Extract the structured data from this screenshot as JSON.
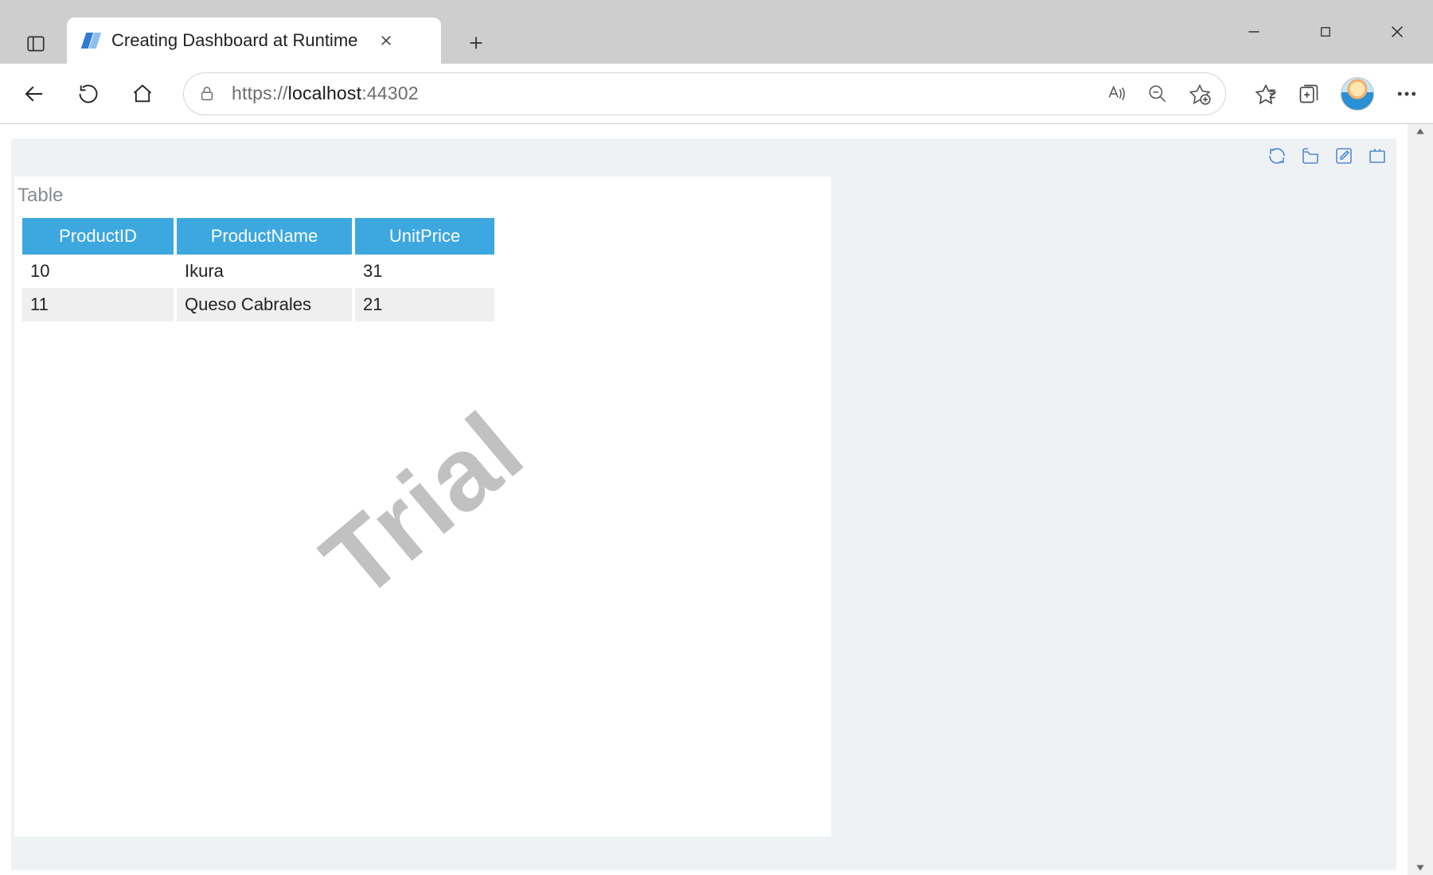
{
  "browser": {
    "tab_title": "Creating Dashboard at Runtime",
    "url_prefix": "https://",
    "url_host": "localhost",
    "url_port": ":44302"
  },
  "report": {
    "card_title": "Table",
    "watermark": "Trial",
    "table": {
      "columns": [
        "ProductID",
        "ProductName",
        "UnitPrice"
      ],
      "rows": [
        {
          "id": "10",
          "name": "Ikura",
          "price": "31"
        },
        {
          "id": "11",
          "name": "Queso Cabrales",
          "price": "21"
        }
      ]
    }
  }
}
